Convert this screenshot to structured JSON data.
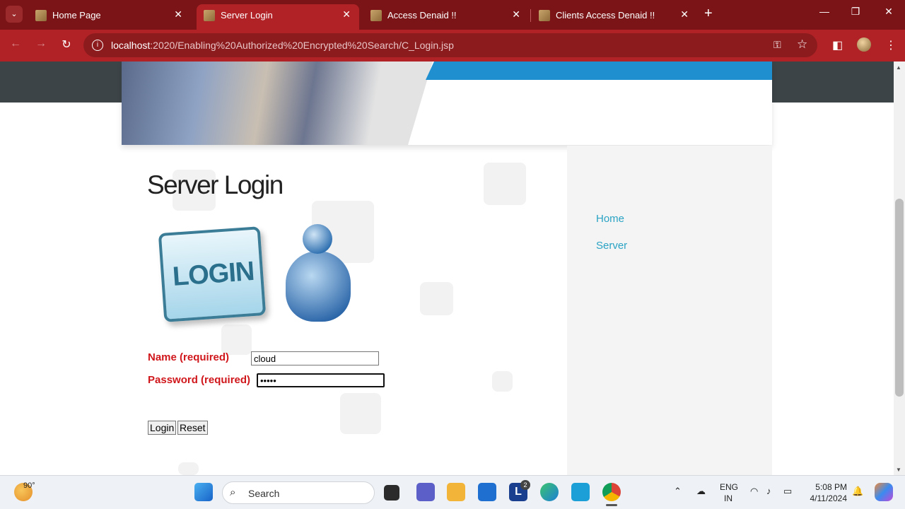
{
  "browser": {
    "tabs": [
      {
        "title": "Home Page",
        "active": false
      },
      {
        "title": "Server Login",
        "active": true
      },
      {
        "title": "Access Denaid !!",
        "active": false
      },
      {
        "title": "Clients Access Denaid !!",
        "active": false
      }
    ],
    "url_host": "localhost",
    "url_path": ":2020/Enabling%20Authorized%20Encrypted%20Search/C_Login.jsp"
  },
  "page": {
    "title": "Server Login",
    "login_sign_text": "LOGIN",
    "sidebar_links": [
      "Home",
      "Server"
    ],
    "form": {
      "name_label": "Name (required)",
      "name_value": "cloud",
      "password_label": "Password (required)",
      "password_value": "•••••",
      "login_button": "Login",
      "reset_button": "Reset"
    }
  },
  "taskbar": {
    "weather_temp": "90°",
    "search_label": "Search",
    "lang_line1": "ENG",
    "lang_line2": "IN",
    "time": "5:08 PM",
    "date": "4/11/2024",
    "badge_count": "2"
  },
  "colors": {
    "tabstrip": "#7a1416",
    "toolbar": "#b02226",
    "field_label": "#d0171c",
    "sidebar_link": "#2aa3c4"
  }
}
